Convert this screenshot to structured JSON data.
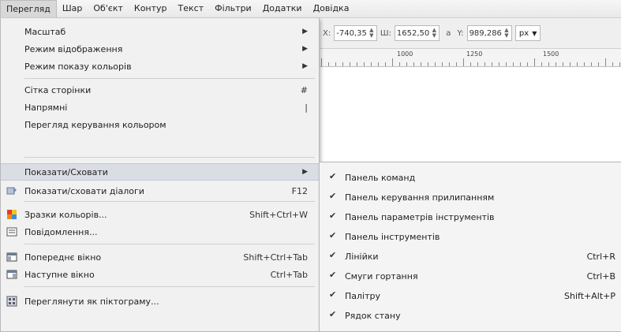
{
  "menubar": {
    "items": [
      "Перегляд",
      "Шар",
      "Об'єкт",
      "Контур",
      "Текст",
      "Фільтри",
      "Додатки",
      "Довідка"
    ]
  },
  "toolbar": {
    "x_label": "X:",
    "x_value": "-740,35",
    "w_label": "Ш:",
    "w_value": "1652,50",
    "y_label": "Y:",
    "y_value": "989,286",
    "unit": "px"
  },
  "ruler": {
    "labels": [
      "1000",
      "1250",
      "1500"
    ]
  },
  "view_menu": {
    "items": [
      {
        "label": "Масштаб",
        "submenu": true
      },
      {
        "label": "Режим відображення",
        "submenu": true
      },
      {
        "label": "Режим показу кольорів",
        "submenu": true
      },
      {
        "label": "Сітка сторінки",
        "shortcut": "#"
      },
      {
        "label": "Напрямні",
        "shortcut": "|"
      },
      {
        "label": "Перегляд керування кольором"
      },
      {
        "label": "Показати/Сховати",
        "submenu": true
      },
      {
        "label": "Показати/сховати діалоги",
        "shortcut": "F12",
        "icon": "dialogs-icon"
      },
      {
        "label": "Зразки кольорів...",
        "shortcut": "Shift+Ctrl+W",
        "icon": "swatches-icon"
      },
      {
        "label": "Повідомлення...",
        "icon": "messages-icon"
      },
      {
        "label": "Попереднє вікно",
        "shortcut": "Shift+Ctrl+Tab",
        "icon": "prev-window-icon"
      },
      {
        "label": "Наступне вікно",
        "shortcut": "Ctrl+Tab",
        "icon": "next-window-icon"
      },
      {
        "label": "Переглянути як піктограму...",
        "icon": "icon-preview-icon"
      }
    ]
  },
  "show_hide_submenu": {
    "items": [
      {
        "label": "Панель команд",
        "checked": true
      },
      {
        "label": "Панель керування прилипанням",
        "checked": true
      },
      {
        "label": "Панель параметрів інструментів",
        "checked": true
      },
      {
        "label": "Панель інструментів",
        "checked": true
      },
      {
        "label": "Лінійки",
        "shortcut": "Ctrl+R",
        "checked": true
      },
      {
        "label": "Смуги гортання",
        "shortcut": "Ctrl+B",
        "checked": true
      },
      {
        "label": "Палітру",
        "shortcut": "Shift+Alt+P",
        "checked": true
      },
      {
        "label": "Рядок стану",
        "checked": true
      }
    ]
  }
}
